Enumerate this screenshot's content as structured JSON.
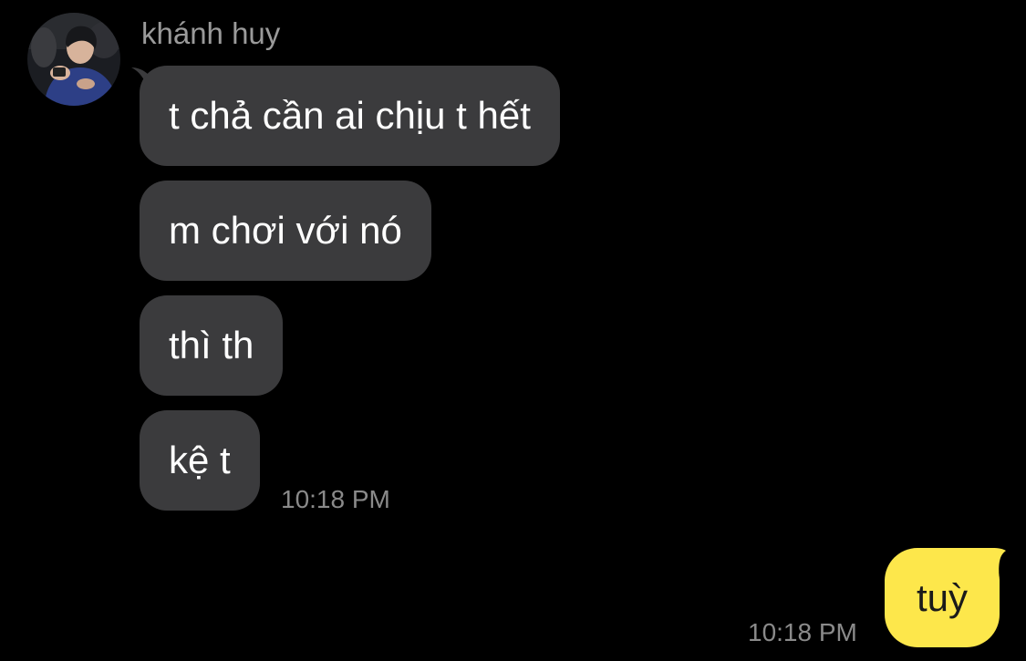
{
  "chat": {
    "sender_name": "khánh huy",
    "messages_in": [
      {
        "text": "t chả cần ai chịu t hết"
      },
      {
        "text": "m chơi với nó"
      },
      {
        "text": "thì th"
      },
      {
        "text": "kệ t"
      }
    ],
    "in_time": "10:18 PM",
    "message_out": {
      "text": "tuỳ"
    },
    "out_time": "10:18 PM"
  },
  "colors": {
    "background": "#000000",
    "incoming_bubble": "#3b3b3d",
    "outgoing_bubble": "#fde74b",
    "timestamp": "#8a8a8a"
  },
  "icons": {
    "avatar": "contact-avatar-photo"
  }
}
